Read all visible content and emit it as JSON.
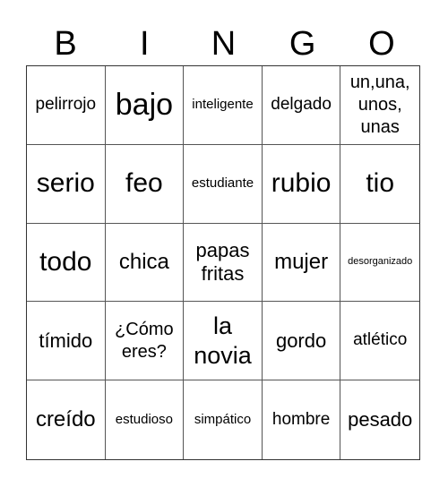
{
  "header": [
    "B",
    "I",
    "N",
    "G",
    "O"
  ],
  "cells": [
    [
      "pelirrojo",
      "bajo",
      "inteligente",
      "delgado",
      "un,una, unos, unas"
    ],
    [
      "serio",
      "feo",
      "estudiante",
      "rubio",
      "tio"
    ],
    [
      "todo",
      "chica",
      "papas fritas",
      "mujer",
      "desorganizado"
    ],
    [
      "tímido",
      "¿Cómo eres?",
      "la novia",
      "gordo",
      "atlético"
    ],
    [
      "creído",
      "estudioso",
      "simpático",
      "hombre",
      "pesado"
    ]
  ]
}
